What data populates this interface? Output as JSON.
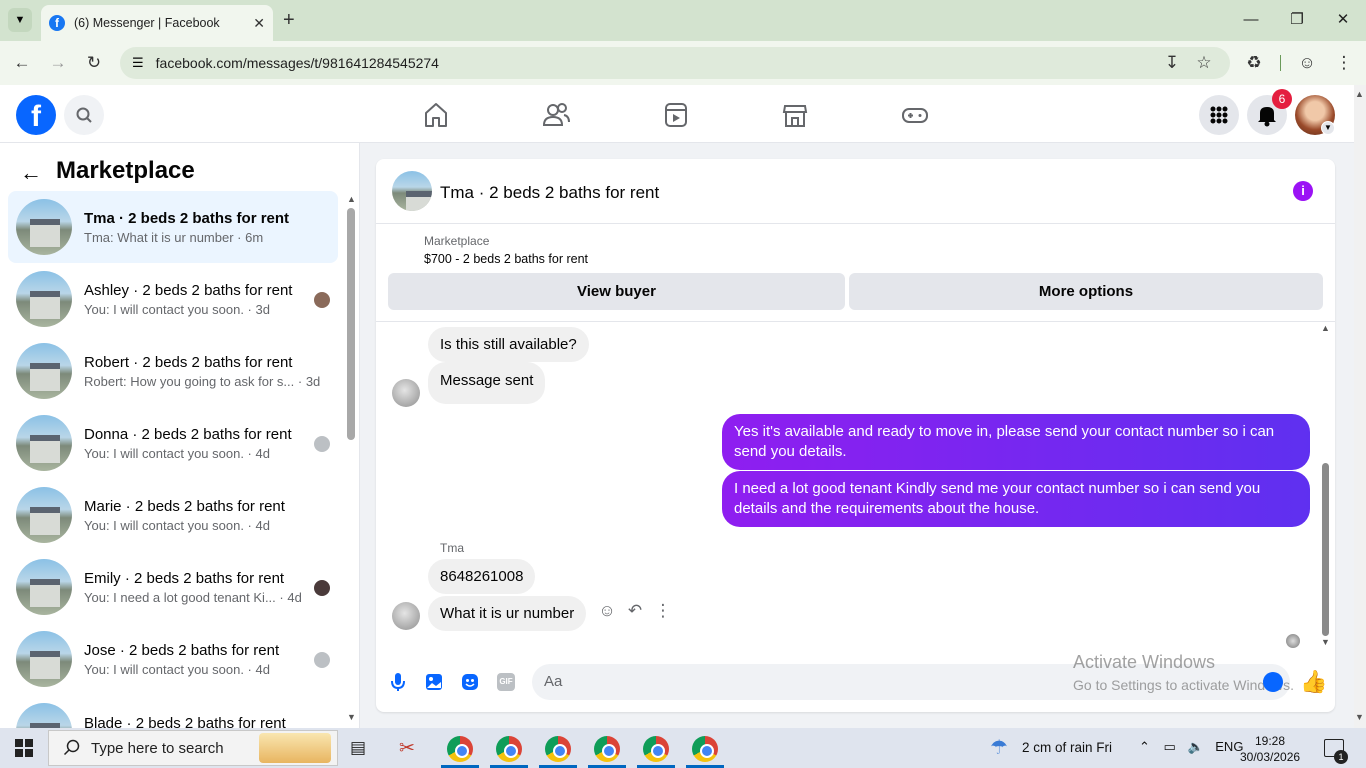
{
  "browser": {
    "tab_title": "(6) Messenger | Facebook",
    "url": "facebook.com/messages/t/981641284545274"
  },
  "header": {
    "notification_count": "6",
    "nav_icons": [
      "home-icon",
      "friends-icon",
      "video-icon",
      "marketplace-icon",
      "gaming-icon"
    ]
  },
  "sidebar": {
    "heading": "Marketplace",
    "conversations": [
      {
        "name": "Tma · 2 beds 2 baths for rent",
        "snippet": "Tma: What it is ur number · 6m",
        "active": true
      },
      {
        "name": "Ashley · 2 beds 2 baths for rent",
        "snippet": "You: I will contact you soon. · 3d"
      },
      {
        "name": "Robert · 2 beds 2 baths for rent",
        "snippet": "Robert: How you going to ask for s... · 3d"
      },
      {
        "name": "Donna · 2 beds 2 baths for rent",
        "snippet": "You: I will contact you soon. · 4d"
      },
      {
        "name": "Marie · 2 beds 2 baths for rent",
        "snippet": "You: I will contact you soon. · 4d"
      },
      {
        "name": "Emily · 2 beds 2 baths for rent",
        "snippet": "You: I need a lot good tenant Ki... · 4d"
      },
      {
        "name": "Jose · 2 beds 2 baths for rent",
        "snippet": "You: I will contact you soon. · 4d"
      },
      {
        "name": "Blade · 2 beds 2 baths for rent",
        "snippet": ""
      }
    ]
  },
  "chat": {
    "title": "Tma · 2 beds 2 baths for rent",
    "listing_label": "Marketplace",
    "listing_price": "$700 - 2 beds 2 baths for rent",
    "view_buyer": "View buyer",
    "more_options": "More options",
    "messages": {
      "m1": "Is this still available?",
      "m2": "Message sent",
      "m3": "Yes it's available and ready to move in, please send your contact number so i can send you details.",
      "m4": "I need a lot good tenant Kindly send me your contact number so i can send you details and the requirements about the house.",
      "sender_name": "Tma",
      "m5": "8648261008",
      "m6": "What it is ur number"
    },
    "composer_placeholder": "Aa",
    "gif_label": "GIF"
  },
  "watermark": {
    "line1": "Activate Windows",
    "line2": "Go to Settings to activate Windows."
  },
  "taskbar": {
    "search_placeholder": "Type here to search",
    "weather": "2 cm of rain Fri",
    "language": "ENG",
    "time": "19:28",
    "date": "30/03/2026",
    "notification_count": "1"
  }
}
